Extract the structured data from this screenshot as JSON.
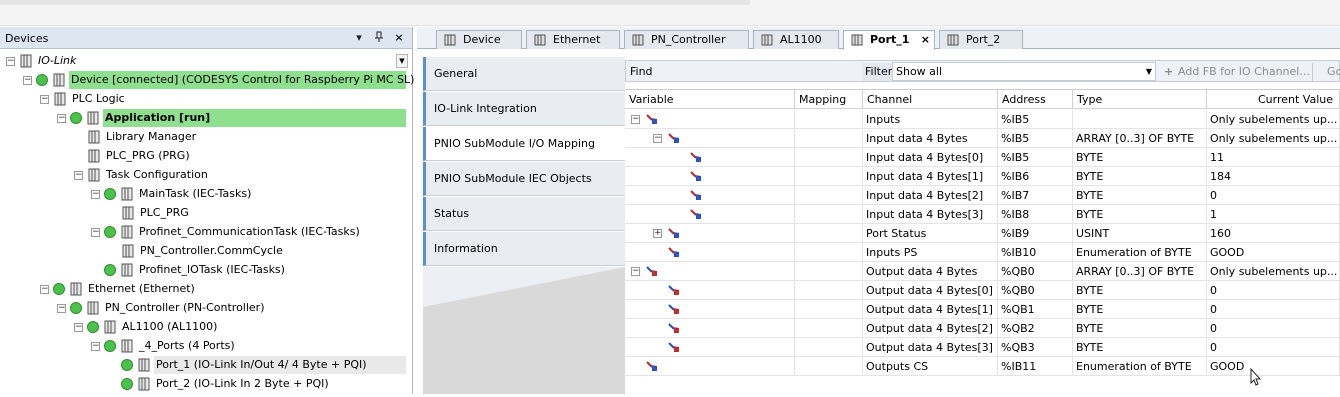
{
  "devices": {
    "title": "Devices",
    "controls": {
      "dropdown": "▾",
      "pin": "📌",
      "close": "×"
    },
    "tree": [
      {
        "label": "IO-Link",
        "depth": 0,
        "italic": true
      },
      {
        "label": "Device [connected] (CODESYS Control for Raspberry Pi MC SL)",
        "depth": 1,
        "highlight": "green"
      },
      {
        "label": "PLC Logic",
        "depth": 2
      },
      {
        "label": "Application [run]",
        "depth": 3,
        "highlight": "green",
        "bold": true
      },
      {
        "label": "Library Manager",
        "depth": 4
      },
      {
        "label": "PLC_PRG (PRG)",
        "depth": 4
      },
      {
        "label": "Task Configuration",
        "depth": 4
      },
      {
        "label": "MainTask (IEC-Tasks)",
        "depth": 5
      },
      {
        "label": "PLC_PRG",
        "depth": 6
      },
      {
        "label": "Profinet_CommunicationTask (IEC-Tasks)",
        "depth": 5
      },
      {
        "label": "PN_Controller.CommCycle",
        "depth": 6
      },
      {
        "label": "Profinet_IOTask (IEC-Tasks)",
        "depth": 5
      },
      {
        "label": "Ethernet (Ethernet)",
        "depth": 2
      },
      {
        "label": "PN_Controller (PN-Controller)",
        "depth": 3
      },
      {
        "label": "AL1100 (AL1100)",
        "depth": 4
      },
      {
        "label": "_4_Ports (4 Ports)",
        "depth": 5
      },
      {
        "label": "Port_1 (IO-Link In/Out  4/ 4 Byte + PQI)",
        "depth": 6,
        "highlight": "gray"
      },
      {
        "label": "Port_2 (IO-Link In  2 Byte + PQI)",
        "depth": 6
      }
    ]
  },
  "tabs": [
    {
      "label": "Device",
      "active": false
    },
    {
      "label": "Ethernet",
      "active": false
    },
    {
      "label": "PN_Controller",
      "active": false
    },
    {
      "label": "AL1100",
      "active": false
    },
    {
      "label": "Port_1",
      "active": true,
      "close": "×"
    },
    {
      "label": "Port_2",
      "active": false
    }
  ],
  "side_tabs": [
    {
      "label": "General",
      "active": false
    },
    {
      "label": "IO-Link Integration",
      "active": false
    },
    {
      "label": "PNIO SubModule I/O Mapping",
      "active": true
    },
    {
      "label": "PNIO SubModule IEC Objects",
      "active": false
    },
    {
      "label": "Status",
      "active": false
    },
    {
      "label": "Information",
      "active": false
    }
  ],
  "find_bar": {
    "find_label": "Find",
    "filter_label": "Filter",
    "filter_value": "Show all",
    "add_fb_label": "Add FB for IO Channel...",
    "goto_label": "Go"
  },
  "grid": {
    "headers": [
      "Variable",
      "Mapping",
      "Channel",
      "Address",
      "Type",
      "Current Value"
    ],
    "rows": [
      {
        "level": 0,
        "exp": "-",
        "dir": "in",
        "channel": "Inputs",
        "address": "%IB5",
        "type": "",
        "value": "Only subelements up..."
      },
      {
        "level": 1,
        "exp": "-",
        "dir": "in",
        "channel": "Input data 4 Bytes",
        "address": "%IB5",
        "type": "ARRAY [0..3] OF BYTE",
        "value": "Only subelements up..."
      },
      {
        "level": 2,
        "exp": "",
        "dir": "in",
        "channel": "Input data 4 Bytes[0]",
        "address": "%IB5",
        "type": "BYTE",
        "value": "11"
      },
      {
        "level": 2,
        "exp": "",
        "dir": "in",
        "channel": "Input data 4 Bytes[1]",
        "address": "%IB6",
        "type": "BYTE",
        "value": "184"
      },
      {
        "level": 2,
        "exp": "",
        "dir": "in",
        "channel": "Input data 4 Bytes[2]",
        "address": "%IB7",
        "type": "BYTE",
        "value": "0"
      },
      {
        "level": 2,
        "exp": "",
        "dir": "in",
        "channel": "Input data 4 Bytes[3]",
        "address": "%IB8",
        "type": "BYTE",
        "value": "1"
      },
      {
        "level": 1,
        "exp": "+",
        "dir": "in",
        "channel": "Port Status",
        "address": "%IB9",
        "type": "USINT",
        "value": "160"
      },
      {
        "level": 1,
        "exp": "",
        "dir": "in",
        "channel": "Inputs PS",
        "address": "%IB10",
        "type": "Enumeration of BYTE",
        "value": "GOOD"
      },
      {
        "level": 0,
        "exp": "-",
        "dir": "out",
        "channel": "Output data 4 Bytes",
        "address": "%QB0",
        "type": "ARRAY [0..3] OF BYTE",
        "value": "Only subelements up..."
      },
      {
        "level": 1,
        "exp": "",
        "dir": "out",
        "channel": "Output data 4 Bytes[0]",
        "address": "%QB0",
        "type": "BYTE",
        "value": "0"
      },
      {
        "level": 1,
        "exp": "",
        "dir": "out",
        "channel": "Output data 4 Bytes[1]",
        "address": "%QB1",
        "type": "BYTE",
        "value": "0"
      },
      {
        "level": 1,
        "exp": "",
        "dir": "out",
        "channel": "Output data 4 Bytes[2]",
        "address": "%QB2",
        "type": "BYTE",
        "value": "0"
      },
      {
        "level": 1,
        "exp": "",
        "dir": "out",
        "channel": "Output data 4 Bytes[3]",
        "address": "%QB3",
        "type": "BYTE",
        "value": "0"
      },
      {
        "level": 0,
        "exp": "",
        "dir": "in",
        "channel": "Outputs CS",
        "address": "%IB11",
        "type": "Enumeration of BYTE",
        "value": "GOOD"
      }
    ]
  },
  "colors": {
    "highlight_green": "#8ee08e",
    "highlight_gray": "#e9e9e9",
    "panel_header": "#dde6f1",
    "side_tab_accent": "#5a8fd0"
  }
}
